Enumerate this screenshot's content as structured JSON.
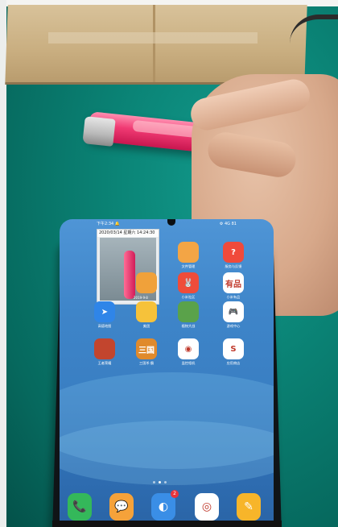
{
  "status_bar": {
    "time": "下午2:34 🔔",
    "right": "⚙ 4G 81"
  },
  "overlay": {
    "timestamp": "2020/03/14 星期六 14:24:30",
    "badge": "2019·9·8"
  },
  "apps": [
    {
      "id": "app-1",
      "label": "文件管理",
      "icon_color": "#f3a545",
      "glyph": ""
    },
    {
      "id": "app-2",
      "label": "服务与反馈",
      "icon_color": "#f04a3b",
      "glyph": "?"
    },
    {
      "id": "app-3",
      "label": "",
      "icon_color": "#f0a13a",
      "glyph": ""
    },
    {
      "id": "app-4",
      "label": "小米社区",
      "icon_color": "#ef4c3a",
      "glyph": "🐰"
    },
    {
      "id": "app-5",
      "label": "小米有品",
      "icon_color": "#ffffff",
      "glyph": "有品"
    },
    {
      "id": "app-6",
      "label": "高德地图",
      "icon_color": "#2f85e8",
      "glyph": "➤"
    },
    {
      "id": "app-7",
      "label": "美团",
      "icon_color": "#f6c23a",
      "glyph": ""
    },
    {
      "id": "app-8",
      "label": "植物大战",
      "icon_color": "#5aa24a",
      "glyph": ""
    },
    {
      "id": "app-9",
      "label": "游戏中心",
      "icon_color": "#ffffff",
      "glyph": "🎮"
    },
    {
      "id": "app-10",
      "label": "王者荣耀",
      "icon_color": "#c2452e",
      "glyph": ""
    },
    {
      "id": "app-11",
      "label": "三国杀·霸",
      "icon_color": "#e08a2c",
      "glyph": "三国"
    },
    {
      "id": "app-12",
      "label": "监控相机",
      "icon_color": "#ffffff",
      "glyph": "◉"
    },
    {
      "id": "app-13",
      "label": "应用商店",
      "icon_color": "#ffffff",
      "glyph": "S"
    }
  ],
  "dock": [
    {
      "id": "dock-phone",
      "icon_color": "#34b85a",
      "glyph": "📞"
    },
    {
      "id": "dock-messages",
      "icon_color": "#f5a23a",
      "glyph": "💬"
    },
    {
      "id": "dock-browser",
      "icon_color": "#3a8ee6",
      "glyph": "◐",
      "badge": "2"
    },
    {
      "id": "dock-camera",
      "icon_color": "#ffffff",
      "glyph": "◎"
    },
    {
      "id": "dock-notes",
      "icon_color": "#f7b52a",
      "glyph": "✎"
    }
  ]
}
